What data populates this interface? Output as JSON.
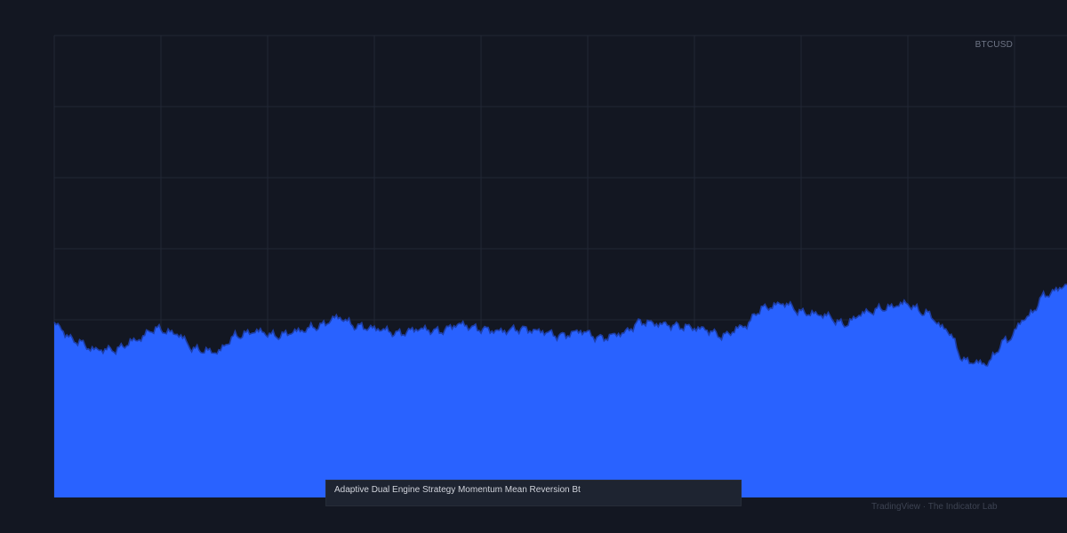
{
  "chart_data": {
    "type": "area",
    "symbol": "BTCUSD",
    "ylim": [
      0,
      100
    ],
    "grid": true,
    "fill_color": "#2962ff",
    "line_color": "#1e3fa8",
    "grid_color": "#222734",
    "x": [
      0,
      2,
      4,
      6,
      8,
      10,
      12,
      14,
      16,
      18,
      20,
      22,
      24,
      26,
      28,
      30,
      32,
      34,
      36,
      38,
      40,
      42,
      44,
      46,
      48,
      50,
      52,
      54,
      56,
      58,
      60,
      62,
      64,
      66,
      68,
      70,
      72,
      74,
      76,
      78,
      80,
      82,
      84,
      86,
      88,
      90,
      92,
      94,
      96,
      98,
      100
    ],
    "values": [
      37.5,
      34,
      32,
      32,
      34,
      36.5,
      35.5,
      32,
      31.5,
      35,
      36,
      35,
      36,
      37,
      39,
      37,
      36.5,
      35.5,
      36.5,
      36,
      37.5,
      36.5,
      36,
      36.5,
      36,
      35,
      36,
      34.5,
      35.5,
      38,
      37.5,
      37,
      36.5,
      35,
      37,
      41,
      42,
      40,
      39.5,
      37.5,
      40,
      41,
      42,
      40,
      36.5,
      29.5,
      29,
      34,
      39,
      44,
      46
    ]
  },
  "caption": "Adaptive Dual Engine Strategy Momentum Mean Reversion Bt",
  "watermark": "TradingView · The Indicator Lab"
}
